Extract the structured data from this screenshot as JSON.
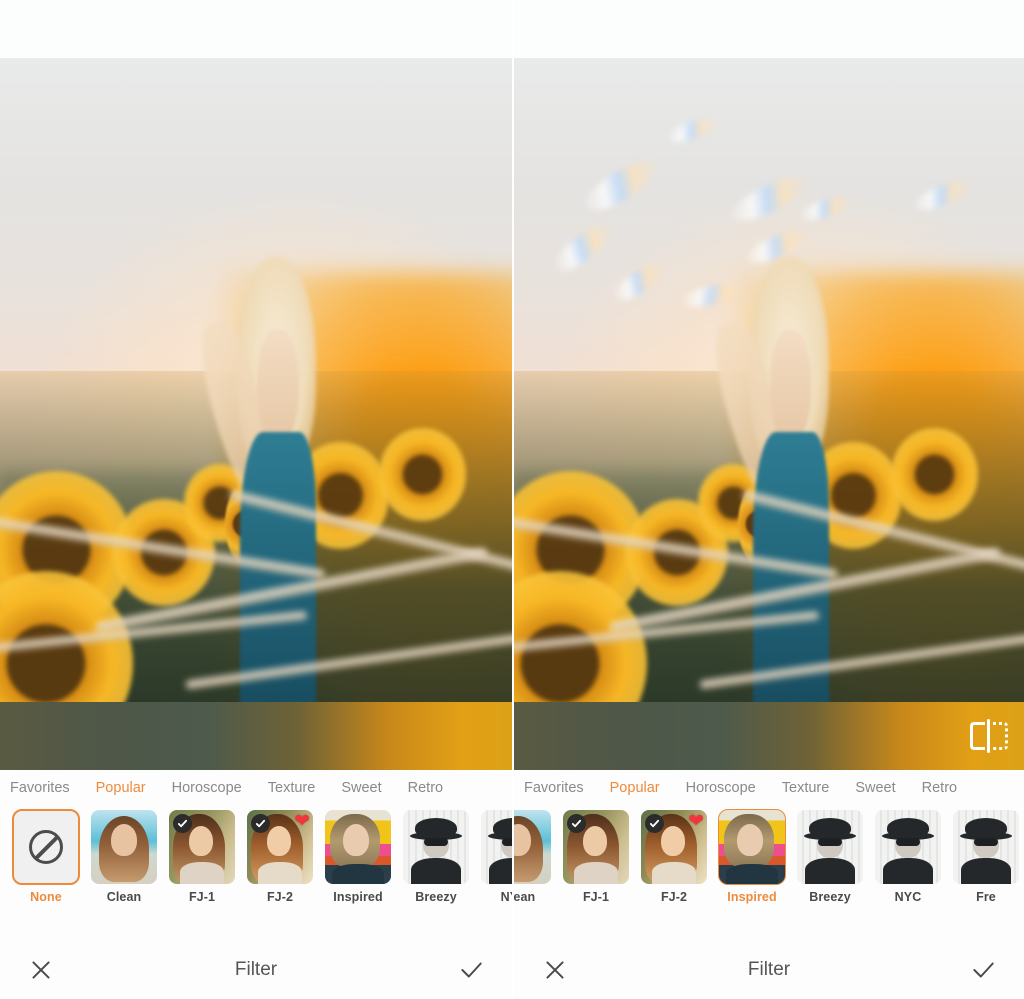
{
  "app": {
    "editor_tool_title": "Filter",
    "accent_color": "#ec8b3c",
    "panel_bg": "#fdfdfd",
    "label_color": "#4a4a4a",
    "tab_inactive_color": "#8a8a8a"
  },
  "panels": [
    {
      "id": "left",
      "name": "before-panel",
      "preview": {
        "compare_icon": "split-compare-icon",
        "compare_icon_visible": false,
        "effect": "none"
      },
      "category_tabs": [
        {
          "label": "Favorites",
          "active": false
        },
        {
          "label": "Popular",
          "active": true
        },
        {
          "label": "Horoscope",
          "active": false
        },
        {
          "label": "Texture",
          "active": false
        },
        {
          "label": "Sweet",
          "active": false
        },
        {
          "label": "Retro",
          "active": false
        }
      ],
      "filters": [
        {
          "label": "None",
          "art": "none",
          "selected": true,
          "checked": false,
          "favorite": false
        },
        {
          "label": "Clean",
          "art": "clean",
          "selected": false,
          "checked": false,
          "favorite": false
        },
        {
          "label": "FJ-1",
          "art": "fj1",
          "selected": false,
          "checked": true,
          "favorite": false
        },
        {
          "label": "FJ-2",
          "art": "fj2",
          "selected": false,
          "checked": true,
          "favorite": true
        },
        {
          "label": "Inspired",
          "art": "insp",
          "selected": false,
          "checked": false,
          "favorite": false
        },
        {
          "label": "Breezy",
          "art": "bw",
          "selected": false,
          "checked": false,
          "favorite": false
        },
        {
          "label": "NYC",
          "art": "bw",
          "selected": false,
          "checked": false,
          "favorite": false
        }
      ],
      "actions": {
        "cancel_icon": "close-icon",
        "title": "Filter",
        "confirm_icon": "check-icon"
      }
    },
    {
      "id": "right",
      "name": "after-panel",
      "preview": {
        "compare_icon": "split-compare-icon",
        "compare_icon_visible": true,
        "effect": "prism-light-leak"
      },
      "category_tabs": [
        {
          "label": "Favorites",
          "active": false
        },
        {
          "label": "Popular",
          "active": true
        },
        {
          "label": "Horoscope",
          "active": false
        },
        {
          "label": "Texture",
          "active": false
        },
        {
          "label": "Sweet",
          "active": false
        },
        {
          "label": "Retro",
          "active": false
        }
      ],
      "filters": [
        {
          "label": "Clean",
          "art": "clean",
          "selected": false,
          "checked": false,
          "favorite": false
        },
        {
          "label": "FJ-1",
          "art": "fj1",
          "selected": false,
          "checked": true,
          "favorite": false
        },
        {
          "label": "FJ-2",
          "art": "fj2",
          "selected": false,
          "checked": true,
          "favorite": true
        },
        {
          "label": "Inspired",
          "art": "insp",
          "selected": true,
          "checked": false,
          "favorite": false
        },
        {
          "label": "Breezy",
          "art": "bw",
          "selected": false,
          "checked": false,
          "favorite": false
        },
        {
          "label": "NYC",
          "art": "bw",
          "selected": false,
          "checked": false,
          "favorite": false
        },
        {
          "label": "Fre",
          "art": "bw",
          "selected": false,
          "checked": false,
          "favorite": false
        }
      ],
      "actions": {
        "cancel_icon": "close-icon",
        "title": "Filter",
        "confirm_icon": "check-icon"
      }
    }
  ]
}
